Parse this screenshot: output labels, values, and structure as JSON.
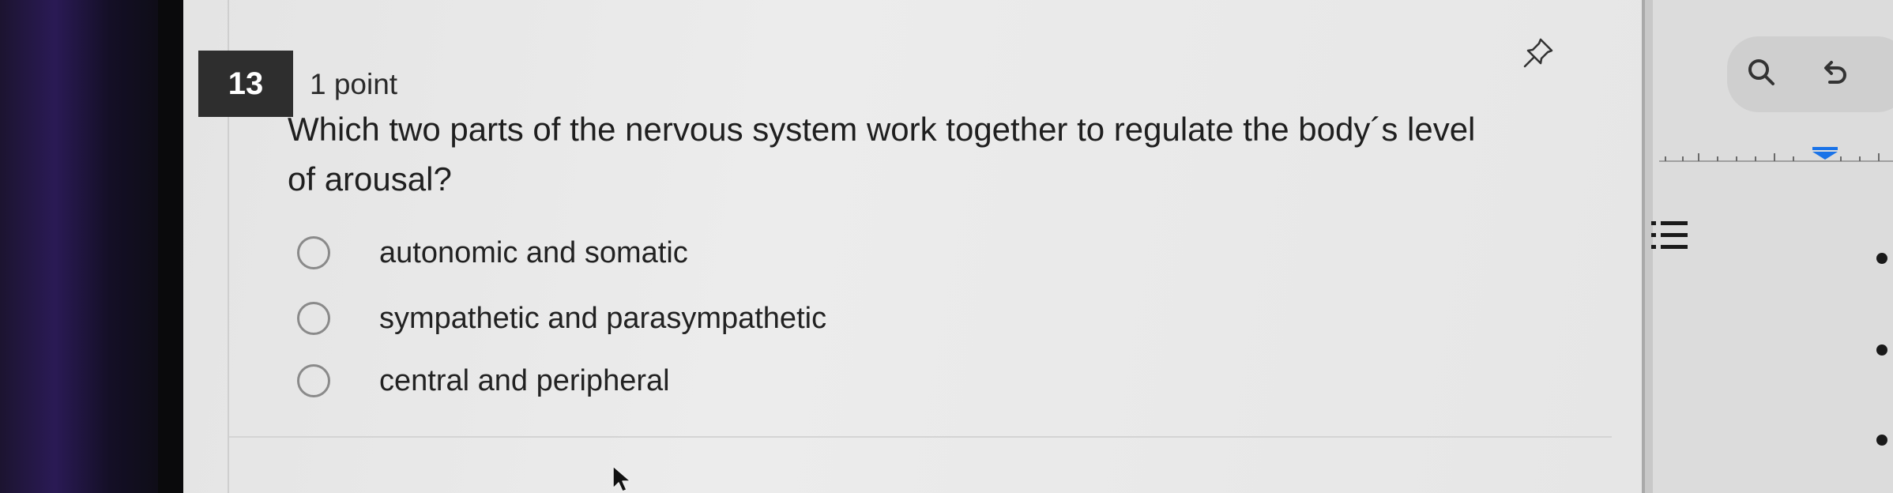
{
  "question": {
    "number": "13",
    "points": "1 point",
    "text": "Which two parts of the nervous system work together to regulate the body´s level of arousal?",
    "options": [
      {
        "label": "autonomic and somatic"
      },
      {
        "label": "sympathetic and parasympathetic"
      },
      {
        "label": "central and peripheral"
      }
    ]
  },
  "icons": {
    "pin": "pin-icon",
    "search": "search-icon",
    "undo": "undo-icon",
    "list": "bulleted-list-icon",
    "cursor": "mouse-cursor-icon"
  }
}
